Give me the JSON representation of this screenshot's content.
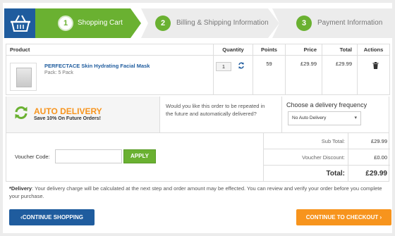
{
  "steps": [
    {
      "num": "1",
      "label": "Shopping Cart"
    },
    {
      "num": "2",
      "label": "Billing & Shipping Information"
    },
    {
      "num": "3",
      "label": "Payment Information"
    }
  ],
  "table": {
    "headers": [
      "Product",
      "Quantity",
      "Points",
      "Price",
      "Total",
      "Actions"
    ],
    "items": [
      {
        "name": "PERFECTACE Skin Hydrating Facial Mask",
        "pack": "Pack: 5 Pack",
        "quantity": "1",
        "points": "59",
        "price": "£29.99",
        "total": "£29.99"
      }
    ]
  },
  "auto_delivery": {
    "title": "AUTO DELIVERY",
    "subtitle": "Save 10% On Future Orders!",
    "question": "Would you like this order to be repeated in the future and automatically delivered?",
    "frequency_title": "Choose a delivery frequency",
    "frequency_selected": "No Auto Delivery"
  },
  "voucher": {
    "label": "Voucher Code:",
    "value": "",
    "apply_label": "APPLY"
  },
  "totals": {
    "subtotal_label": "Sub Total:",
    "subtotal": "£29.99",
    "discount_label": "Voucher Discount:",
    "discount": "£0.00",
    "total_label": "Total:",
    "total": "£29.99"
  },
  "note": {
    "bold": "*Delivery",
    "text": ": Your delivery charge will be calculated at the next step and order amount may be effected. You can review and verify your order before you complete your purchase."
  },
  "buttons": {
    "continue_shopping": "CONTINUE SHOPPING",
    "continue_checkout": "CONTINUE TO CHECKOUT"
  },
  "colors": {
    "brand_blue": "#1f5c9e",
    "green": "#6ab131",
    "orange": "#f7941d"
  }
}
